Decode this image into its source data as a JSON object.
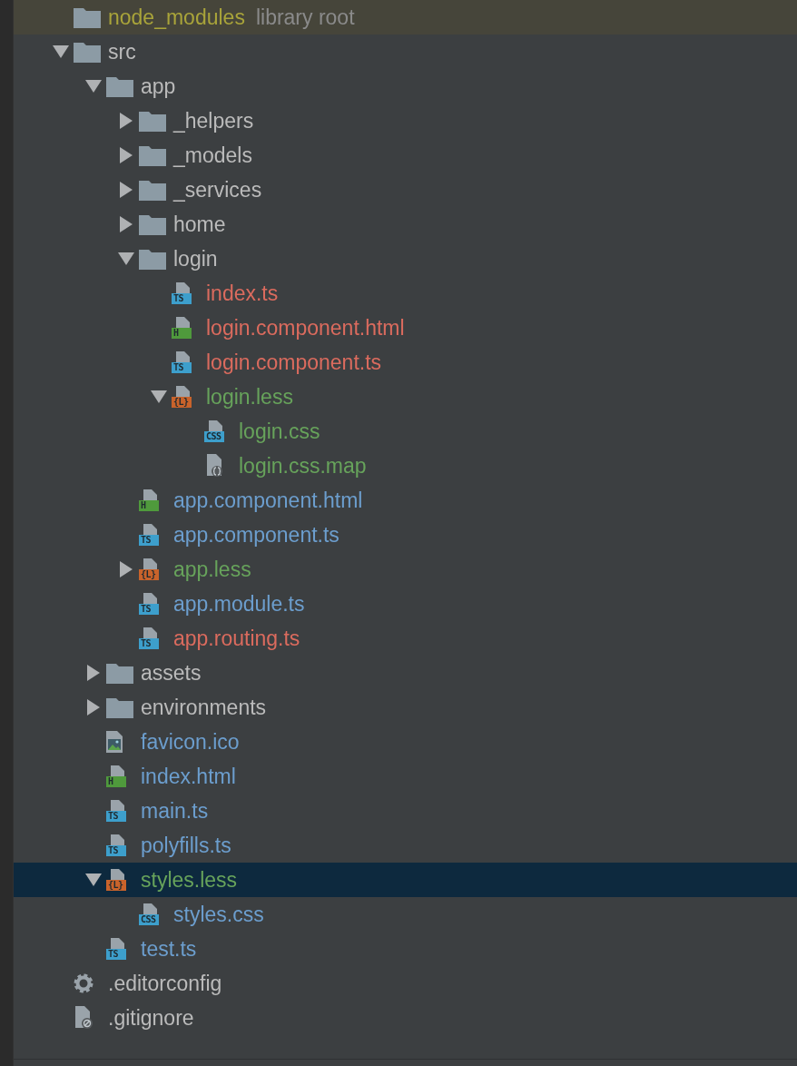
{
  "tree": [
    {
      "kind": "folder",
      "name": "node_modules",
      "note": "library root",
      "color": "#a9a43a",
      "selected": false
    },
    {
      "kind": "folder",
      "name": "src",
      "color": "#bbbbbb",
      "expanded": true,
      "selected": false,
      "children": [
        {
          "kind": "folder",
          "name": "app",
          "color": "#bbbbbb",
          "expanded": true,
          "selected": false,
          "children": [
            {
              "kind": "folder",
              "name": "_helpers",
              "color": "#bbbbbb",
              "expanded": false,
              "selected": false
            },
            {
              "kind": "folder",
              "name": "_models",
              "color": "#bbbbbb",
              "expanded": false,
              "selected": false
            },
            {
              "kind": "folder",
              "name": "_services",
              "color": "#bbbbbb",
              "expanded": false,
              "selected": false
            },
            {
              "kind": "folder",
              "name": "home",
              "color": "#bbbbbb",
              "expanded": false,
              "selected": false
            },
            {
              "kind": "folder",
              "name": "login",
              "color": "#bbbbbb",
              "expanded": true,
              "selected": false,
              "children": [
                {
                  "kind": "ts",
                  "badge": "TS",
                  "name": "index.ts",
                  "color": "#db6b5e",
                  "selected": false
                },
                {
                  "kind": "html",
                  "badge": "H",
                  "name": "login.component.html",
                  "color": "#db6b5e",
                  "selected": false
                },
                {
                  "kind": "ts",
                  "badge": "TS",
                  "name": "login.component.ts",
                  "color": "#db6b5e",
                  "selected": false
                },
                {
                  "kind": "less",
                  "badge": "{L}",
                  "name": "login.less",
                  "color": "#67a35b",
                  "expanded": true,
                  "selected": false,
                  "children": [
                    {
                      "kind": "css",
                      "badge": "CSS",
                      "name": "login.css",
                      "color": "#67a35b",
                      "selected": false
                    },
                    {
                      "kind": "map",
                      "name": "login.css.map",
                      "color": "#67a35b",
                      "selected": false
                    }
                  ]
                }
              ]
            },
            {
              "kind": "html",
              "badge": "H",
              "name": "app.component.html",
              "color": "#6c9ece",
              "selected": false
            },
            {
              "kind": "ts",
              "badge": "TS",
              "name": "app.component.ts",
              "color": "#6c9ece",
              "selected": false
            },
            {
              "kind": "less",
              "badge": "{L}",
              "name": "app.less",
              "color": "#67a35b",
              "expanded": false,
              "selected": false
            },
            {
              "kind": "ts",
              "badge": "TS",
              "name": "app.module.ts",
              "color": "#6c9ece",
              "selected": false
            },
            {
              "kind": "ts",
              "badge": "TS",
              "name": "app.routing.ts",
              "color": "#db6b5e",
              "selected": false
            }
          ]
        },
        {
          "kind": "folder",
          "name": "assets",
          "color": "#bbbbbb",
          "expanded": false,
          "selected": false
        },
        {
          "kind": "folder",
          "name": "environments",
          "color": "#bbbbbb",
          "expanded": false,
          "selected": false
        },
        {
          "kind": "image",
          "name": "favicon.ico",
          "color": "#6c9ece",
          "selected": false
        },
        {
          "kind": "html",
          "badge": "H",
          "name": "index.html",
          "color": "#6c9ece",
          "selected": false
        },
        {
          "kind": "ts",
          "badge": "TS",
          "name": "main.ts",
          "color": "#6c9ece",
          "selected": false
        },
        {
          "kind": "ts",
          "badge": "TS",
          "name": "polyfills.ts",
          "color": "#6c9ece",
          "selected": false
        },
        {
          "kind": "less",
          "badge": "{L}",
          "name": "styles.less",
          "color": "#67a35b",
          "expanded": true,
          "selected": true,
          "children": [
            {
              "kind": "css",
              "badge": "CSS",
              "name": "styles.css",
              "color": "#6c9ece",
              "selected": false
            }
          ]
        },
        {
          "kind": "ts",
          "badge": "TS",
          "name": "test.ts",
          "color": "#6c9ece",
          "selected": false
        }
      ]
    },
    {
      "kind": "config",
      "name": ".editorconfig",
      "color": "#bbbbbb",
      "selected": false
    },
    {
      "kind": "ignore",
      "name": ".gitignore",
      "color": "#bbbbbb",
      "selected": false
    }
  ]
}
